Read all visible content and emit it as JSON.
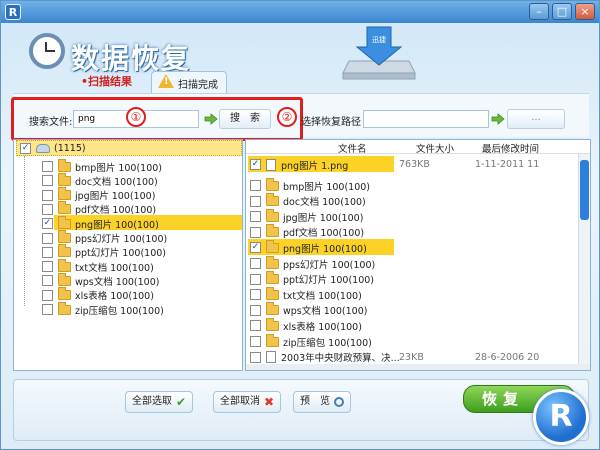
{
  "window": {
    "app_icon_letter": "R",
    "minimize": "–",
    "maximize": "□",
    "close": "×"
  },
  "header": {
    "app_title": "数据恢复",
    "hdd_label": "迅捷",
    "tab_results": "•扫描结果",
    "tab_done": "扫描完成"
  },
  "search": {
    "label": "搜索文件:",
    "value": "png",
    "button": "搜　索",
    "marker_1": "①",
    "marker_2": "②",
    "path_label": "选择恢复路径",
    "path_value": "",
    "browse_button": "..."
  },
  "tree": {
    "root": {
      "label": "(1115)",
      "checked": true
    },
    "items": [
      {
        "label": "bmp图片 100(100)",
        "checked": false,
        "selected": false
      },
      {
        "label": "doc文档 100(100)",
        "checked": false,
        "selected": false
      },
      {
        "label": "jpg图片 100(100)",
        "checked": false,
        "selected": false
      },
      {
        "label": "pdf文档 100(100)",
        "checked": false,
        "selected": false
      },
      {
        "label": "png图片 100(100)",
        "checked": true,
        "selected": true
      },
      {
        "label": "pps幻灯片 100(100)",
        "checked": false,
        "selected": false
      },
      {
        "label": "ppt幻灯片 100(100)",
        "checked": false,
        "selected": false
      },
      {
        "label": "txt文档 100(100)",
        "checked": false,
        "selected": false
      },
      {
        "label": "wps文档 100(100)",
        "checked": false,
        "selected": false
      },
      {
        "label": "xls表格 100(100)",
        "checked": false,
        "selected": false
      },
      {
        "label": "zip压缩包 100(100)",
        "checked": false,
        "selected": false
      }
    ]
  },
  "file_list": {
    "columns": {
      "name": "文件名",
      "size": "文件大小",
      "modified": "最后修改时间"
    },
    "rows": [
      {
        "type": "file",
        "name": "png图片 1.png",
        "size": "763KB",
        "modified": "1-11-2011 11",
        "checked": true,
        "selected": true
      },
      {
        "type": "folder",
        "name": "bmp图片 100(100)",
        "size": "",
        "modified": "",
        "checked": false,
        "selected": false
      },
      {
        "type": "folder",
        "name": "doc文档 100(100)",
        "size": "",
        "modified": "",
        "checked": false,
        "selected": false
      },
      {
        "type": "folder",
        "name": "jpg图片 100(100)",
        "size": "",
        "modified": "",
        "checked": false,
        "selected": false
      },
      {
        "type": "folder",
        "name": "pdf文档 100(100)",
        "size": "",
        "modified": "",
        "checked": false,
        "selected": false
      },
      {
        "type": "folder",
        "name": "png图片 100(100)",
        "size": "",
        "modified": "",
        "checked": true,
        "selected": true
      },
      {
        "type": "folder",
        "name": "pps幻灯片 100(100)",
        "size": "",
        "modified": "",
        "checked": false,
        "selected": false
      },
      {
        "type": "folder",
        "name": "ppt幻灯片 100(100)",
        "size": "",
        "modified": "",
        "checked": false,
        "selected": false
      },
      {
        "type": "folder",
        "name": "txt文档 100(100)",
        "size": "",
        "modified": "",
        "checked": false,
        "selected": false
      },
      {
        "type": "folder",
        "name": "wps文档 100(100)",
        "size": "",
        "modified": "",
        "checked": false,
        "selected": false
      },
      {
        "type": "folder",
        "name": "xls表格 100(100)",
        "size": "",
        "modified": "",
        "checked": false,
        "selected": false
      },
      {
        "type": "folder",
        "name": "zip压缩包 100(100)",
        "size": "",
        "modified": "",
        "checked": false,
        "selected": false
      },
      {
        "type": "file",
        "name": "2003年中央财政预算、决...",
        "size": "23KB",
        "modified": "28-6-2006 20",
        "checked": false,
        "selected": false
      }
    ]
  },
  "bottom": {
    "select_all": "全部选取",
    "deselect_all": "全部取消",
    "preview": "预　览",
    "recover": "恢复",
    "logo_letter": "R"
  },
  "colors": {
    "highlight_red": "#e21d1d",
    "selection_yellow": "#fcd226",
    "recover_green": "#3e9f1d",
    "brand_blue": "#1f6fd0"
  }
}
